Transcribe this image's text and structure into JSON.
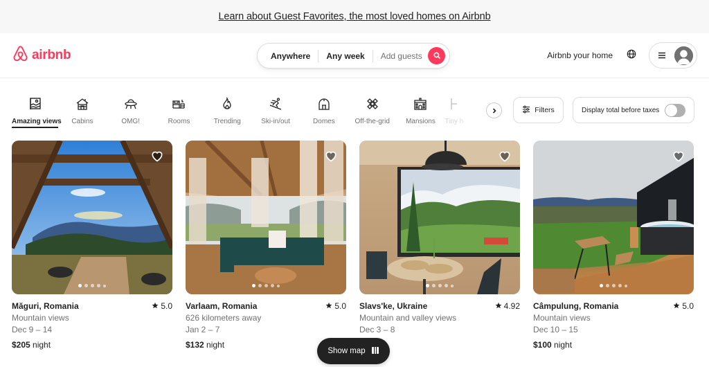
{
  "banner": {
    "text": "Learn about Guest Favorites, the most loved homes on Airbnb"
  },
  "header": {
    "logo_text": "airbnb",
    "brand_color": "#ff385c",
    "search": {
      "where": "Anywhere",
      "when": "Any week",
      "who_placeholder": "Add guests",
      "button_icon": "search-icon"
    },
    "host_link": "Airbnb your home",
    "globe_icon": "globe-icon",
    "menu_icon": "hamburger-icon",
    "avatar_icon": "user-avatar-icon"
  },
  "categories": {
    "items": [
      {
        "label": "Amazing views",
        "icon": "amazing-views-icon",
        "active": true
      },
      {
        "label": "Cabins",
        "icon": "cabin-icon",
        "active": false
      },
      {
        "label": "OMG!",
        "icon": "ufo-icon",
        "active": false
      },
      {
        "label": "Rooms",
        "icon": "rooms-icon",
        "active": false
      },
      {
        "label": "Trending",
        "icon": "flame-icon",
        "active": false
      },
      {
        "label": "Ski-in/out",
        "icon": "skier-icon",
        "active": false
      },
      {
        "label": "Domes",
        "icon": "dome-icon",
        "active": false
      },
      {
        "label": "Off-the-grid",
        "icon": "off-grid-icon",
        "active": false
      },
      {
        "label": "Mansions",
        "icon": "mansion-icon",
        "active": false
      },
      {
        "label": "Tiny homes",
        "icon": "tiny-home-icon",
        "active": false
      }
    ],
    "filters_label": "Filters",
    "tax_toggle_label": "Display total before taxes",
    "tax_toggle_on": false
  },
  "listings": [
    {
      "location": "Măguri, Romania",
      "rating": "5.0",
      "subtitle": "Mountain views",
      "dates": "Dec 9 – 14",
      "price": "$205",
      "price_unit": "night",
      "photo_count": 5,
      "photo_index": 0
    },
    {
      "location": "Varlaam, Romania",
      "rating": "5.0",
      "subtitle": "626 kilometers away",
      "dates": "Jan 2 – 7",
      "price": "$132",
      "price_unit": "night",
      "photo_count": 5,
      "photo_index": 0
    },
    {
      "location": "Slavs'ke, Ukraine",
      "rating": "4.92",
      "subtitle": "Mountain and valley views",
      "dates": "Dec 3 – 8",
      "price": "",
      "price_unit": "night",
      "photo_count": 5,
      "photo_index": 0
    },
    {
      "location": "Câmpulung, Romania",
      "rating": "5.0",
      "subtitle": "Mountain views",
      "dates": "Dec 10 – 15",
      "price": "$100",
      "price_unit": "night",
      "photo_count": 5,
      "photo_index": 0
    }
  ],
  "show_map": {
    "label": "Show map",
    "icon": "map-icon"
  }
}
